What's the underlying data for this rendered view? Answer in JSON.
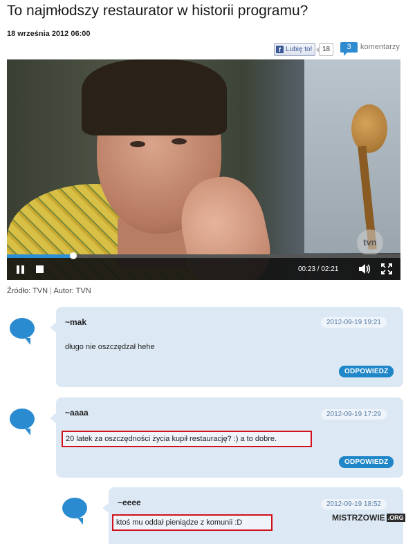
{
  "article": {
    "title": "To najmłodszy restaurator w historii programu?",
    "date": "18 września 2012 06:00"
  },
  "social": {
    "like_label": "Lubię to!",
    "like_count": "18",
    "comments_count": "3",
    "comments_label": "komentarzy"
  },
  "video": {
    "watermark": "tvn",
    "time": "00:23 / 02:21",
    "progress": 0.168,
    "icons": [
      "pause-icon",
      "stop-icon",
      "volume-icon",
      "fullscreen-icon"
    ]
  },
  "source": {
    "source_text": "Źródło: TVN",
    "separator": "|",
    "author_text": "Autor: TVN"
  },
  "comments": [
    {
      "author": "~mak",
      "timestamp": "2012-09-19 19:21",
      "text": "długo nie oszczędzał hehe",
      "reply_label": "ODPOWIEDZ"
    },
    {
      "author": "~aaaa",
      "timestamp": "2012-09-19 17:29",
      "text": "20 latek za oszczędności życia kupił restaurację? :) a to dobre.",
      "reply_label": "ODPOWIEDZ"
    },
    {
      "author": "~eeee",
      "timestamp": "2012-09-19 18:52",
      "text": "ktoś mu oddał pieniądze z komunii :D"
    }
  ],
  "watermark": {
    "site": "MISTRZOWIE",
    "tld": ".ORG"
  },
  "colors": {
    "accent": "#1f86c7",
    "bubble": "#2b8bd0",
    "comment_bg": "#dce9f5",
    "highlight": "#d0101a"
  }
}
